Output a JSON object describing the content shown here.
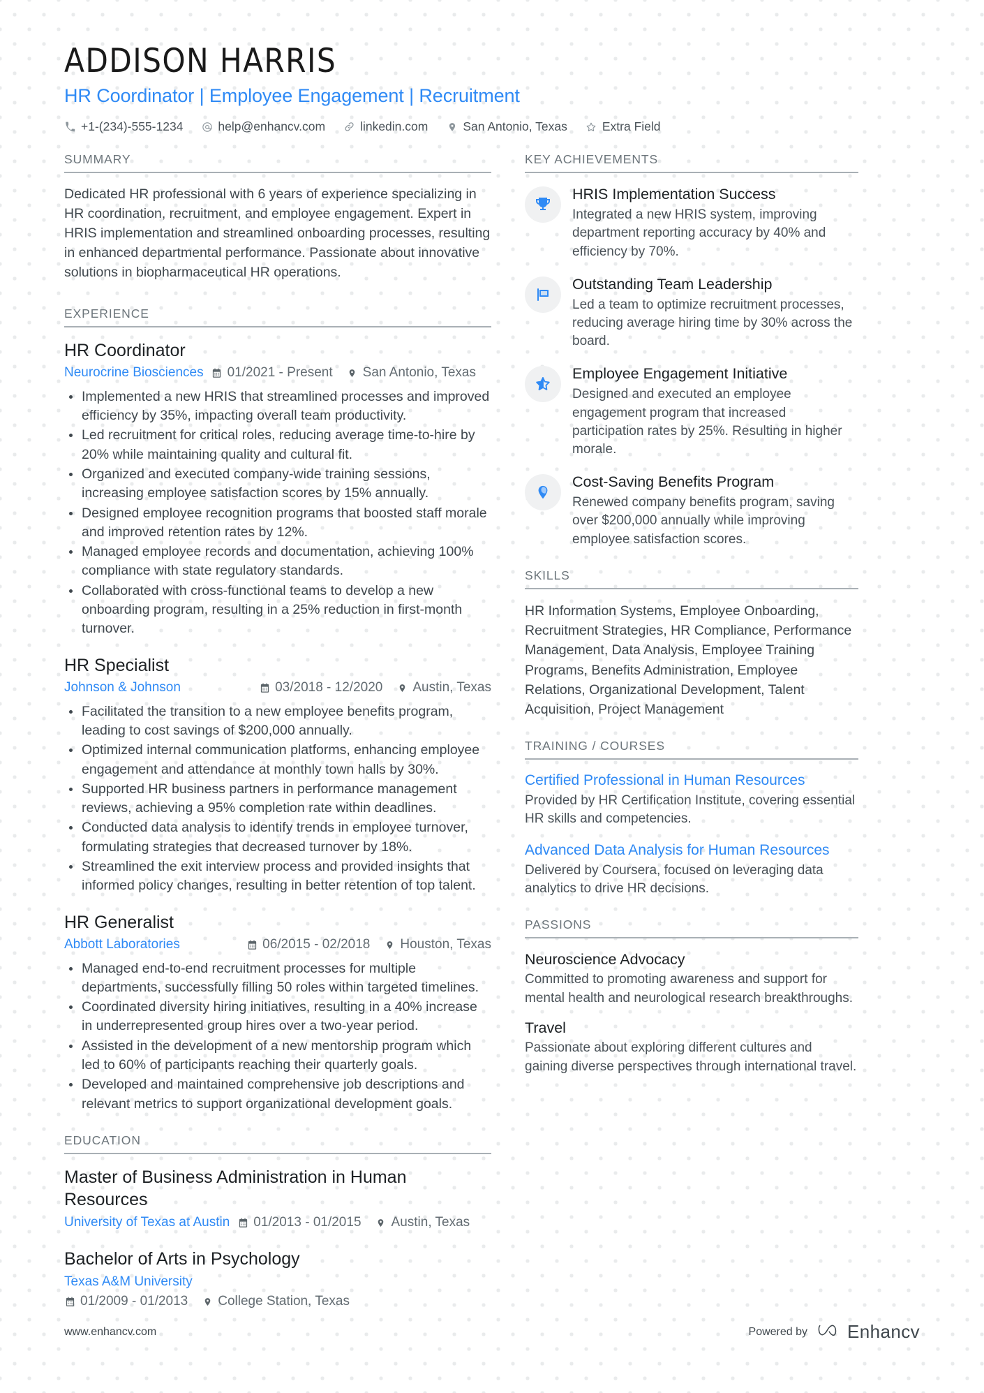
{
  "header": {
    "name": "ADDISON HARRIS",
    "headline": "HR Coordinator | Employee Engagement | Recruitment",
    "contacts": [
      {
        "icon": "phone-icon",
        "text": "+1-(234)-555-1234"
      },
      {
        "icon": "email-icon",
        "text": "help@enhancv.com"
      },
      {
        "icon": "link-icon",
        "text": "linkedin.com"
      },
      {
        "icon": "location-pin-icon",
        "text": "San Antonio, Texas"
      },
      {
        "icon": "star-outline-icon",
        "text": "Extra Field"
      }
    ]
  },
  "sections": {
    "summary_title": "SUMMARY",
    "experience_title": "EXPERIENCE",
    "education_title": "EDUCATION",
    "achievements_title": "KEY ACHIEVEMENTS",
    "skills_title": "SKILLS",
    "training_title": "TRAINING / COURSES",
    "passions_title": "PASSIONS"
  },
  "summary": {
    "text": "Dedicated HR professional with 6 years of experience specializing in HR coordination, recruitment, and employee engagement. Expert in HRIS implementation and streamlined onboarding processes, resulting in enhanced departmental performance. Passionate about innovative solutions in biopharmaceutical HR operations."
  },
  "experience": [
    {
      "title": "HR Coordinator",
      "org": "Neurocrine Biosciences",
      "dates": "01/2021 - Present",
      "location": "San Antonio, Texas",
      "meta_spread": false,
      "bullets": [
        "Implemented a new HRIS that streamlined processes and improved efficiency by 35%, impacting overall team productivity.",
        "Led recruitment for critical roles, reducing average time-to-hire by 20% while maintaining quality and cultural fit.",
        "Organized and executed company-wide training sessions, increasing employee satisfaction scores by 15% annually.",
        "Designed employee recognition programs that boosted staff morale and improved retention rates by 12%.",
        "Managed employee records and documentation, achieving 100% compliance with state regulatory standards.",
        "Collaborated with cross-functional teams to develop a new onboarding program, resulting in a 25% reduction in first-month turnover."
      ]
    },
    {
      "title": "HR Specialist",
      "org": "Johnson & Johnson",
      "dates": "03/2018 - 12/2020",
      "location": "Austin, Texas",
      "meta_spread": true,
      "bullets": [
        "Facilitated the transition to a new employee benefits program, leading to cost savings of $200,000 annually.",
        "Optimized internal communication platforms, enhancing employee engagement and attendance at monthly town halls by 30%.",
        "Supported HR business partners in performance management reviews, achieving a 95% completion rate within deadlines.",
        "Conducted data analysis to identify trends in employee turnover, formulating strategies that decreased turnover by 18%.",
        "Streamlined the exit interview process and provided insights that informed policy changes, resulting in better retention of top talent."
      ]
    },
    {
      "title": "HR Generalist",
      "org": "Abbott Laboratories",
      "dates": "06/2015 - 02/2018",
      "location": "Houston, Texas",
      "meta_spread": true,
      "bullets": [
        "Managed end-to-end recruitment processes for multiple departments, successfully filling 50 roles within targeted timelines.",
        "Coordinated diversity hiring initiatives, resulting in a 40% increase in underrepresented group hires over a two-year period.",
        "Assisted in the development of a new mentorship program which led to 60% of participants reaching their quarterly goals.",
        "Developed and maintained comprehensive job descriptions and relevant metrics to support organizational development goals."
      ]
    }
  ],
  "education": [
    {
      "title": "Master of Business Administration in Human Resources",
      "org": "University of Texas at Austin",
      "dates": "01/2013 - 01/2015",
      "location": "Austin, Texas",
      "wrap": false
    },
    {
      "title": "Bachelor of Arts in Psychology",
      "org": "Texas A&M University",
      "dates": "01/2009 - 01/2013",
      "location": "College Station, Texas",
      "wrap": true
    }
  ],
  "achievements": [
    {
      "icon": "trophy-icon",
      "title": "HRIS Implementation Success",
      "desc": "Integrated a new HRIS system, improving department reporting accuracy by 40% and efficiency by 70%."
    },
    {
      "icon": "flag-icon",
      "title": "Outstanding Team Leadership",
      "desc": "Led a team to optimize recruitment processes, reducing average hiring time by 30% across the board."
    },
    {
      "icon": "star-icon",
      "title": "Employee Engagement Initiative",
      "desc": "Designed and executed an employee engagement program that increased participation rates by 25%. Resulting in higher morale."
    },
    {
      "icon": "pin-icon",
      "title": "Cost-Saving Benefits Program",
      "desc": "Renewed company benefits program, saving over $200,000 annually while improving employee satisfaction scores."
    }
  ],
  "skills": {
    "text": "HR Information Systems, Employee Onboarding, Recruitment Strategies, HR Compliance, Performance Management, Data Analysis, Employee Training Programs, Benefits Administration, Employee Relations, Organizational Development, Talent Acquisition, Project Management"
  },
  "courses": [
    {
      "title": "Certified Professional in Human Resources",
      "desc": "Provided by HR Certification Institute, covering essential HR skills and competencies."
    },
    {
      "title": "Advanced Data Analysis for Human Resources",
      "desc": "Delivered by Coursera, focused on leveraging data analytics to drive HR decisions."
    }
  ],
  "passions": [
    {
      "title": "Neuroscience Advocacy",
      "desc": "Committed to promoting awareness and support for mental health and neurological research breakthroughs."
    },
    {
      "title": "Travel",
      "desc": "Passionate about exploring different cultures and gaining diverse perspectives through international travel."
    }
  ],
  "footer": {
    "url": "www.enhancv.com",
    "powered_by": "Powered by",
    "brand": "Enhancv"
  },
  "colors": {
    "accent": "#2f8af5",
    "text": "#3f474d",
    "muted": "#6c757b",
    "rule": "#a9b0b5",
    "badge_bg": "#f0f1f2"
  }
}
